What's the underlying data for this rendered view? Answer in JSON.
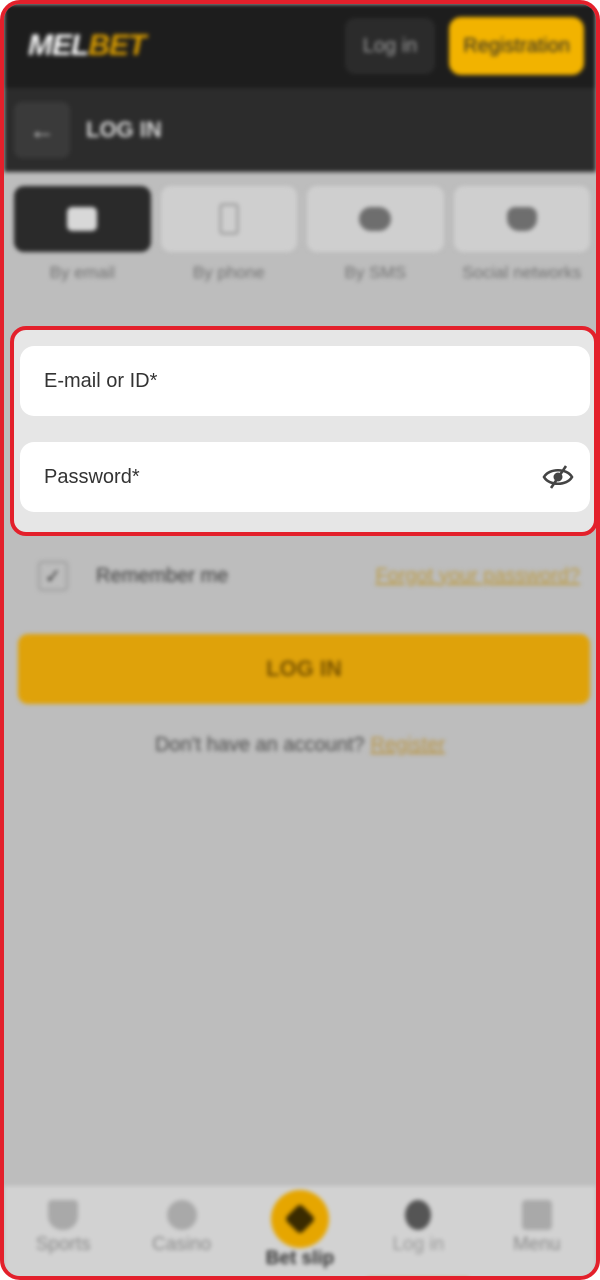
{
  "header": {
    "logo_part1": "MEL",
    "logo_part2": "BET",
    "login_label": "Log in",
    "registration_label": "Registration"
  },
  "subheader": {
    "title": "LOG IN"
  },
  "methods": [
    {
      "label": "By email",
      "icon": "email-icon",
      "active": true
    },
    {
      "label": "By phone",
      "icon": "phone-icon",
      "active": false
    },
    {
      "label": "By SMS",
      "icon": "sms-icon",
      "active": false
    },
    {
      "label": "Social networks",
      "icon": "social-icon",
      "active": false
    }
  ],
  "form": {
    "email_placeholder": "E-mail or ID*",
    "password_placeholder": "Password*"
  },
  "remember": {
    "label": "Remember me",
    "checked": true,
    "forgot_label": "Forgot your password?"
  },
  "login_button_label": "LOG IN",
  "register": {
    "question": "Don't have an account?",
    "link_label": "Register"
  },
  "bottom_nav": [
    {
      "label": "Sports",
      "icon": "trophy-icon"
    },
    {
      "label": "Casino",
      "icon": "casino-icon"
    },
    {
      "label": "Bet slip",
      "icon": "bet-slip-icon"
    },
    {
      "label": "Log in",
      "icon": "person-icon",
      "active": true
    },
    {
      "label": "Menu",
      "icon": "menu-icon"
    }
  ],
  "colors": {
    "highlight": "#e3202b",
    "accent": "#f2b300"
  }
}
